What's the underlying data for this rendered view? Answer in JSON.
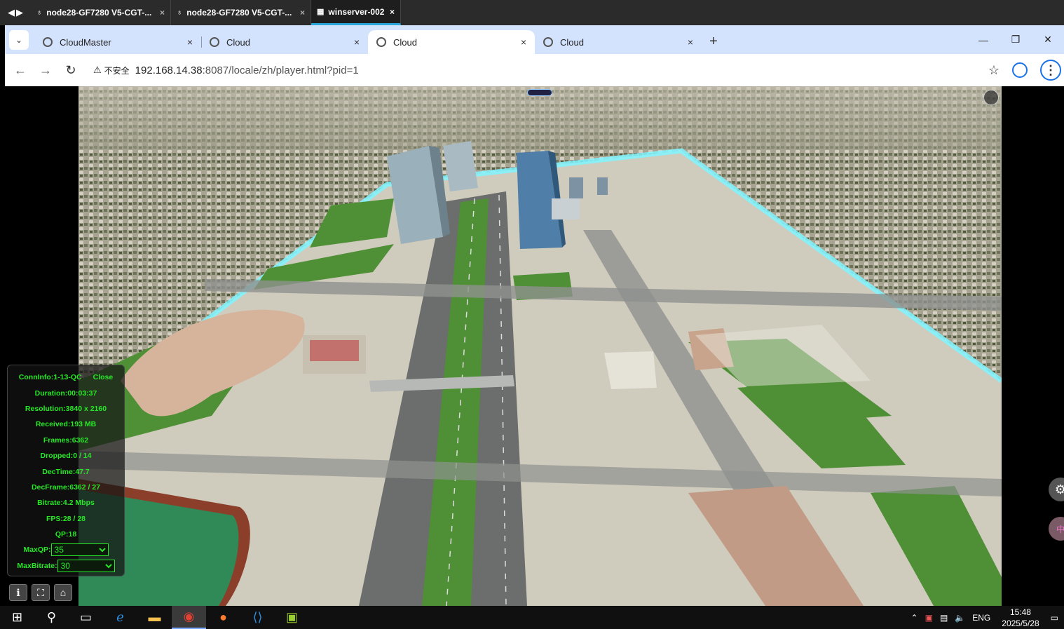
{
  "rdp": {
    "tabs": [
      {
        "label": "node28-GF7280 V5-CGT-...",
        "close": "×"
      },
      {
        "label": "node28-GF7280 V5-CGT-...",
        "close": "×"
      },
      {
        "label": "winserver-002",
        "close": "×",
        "active": true
      }
    ]
  },
  "browser": {
    "tabs": [
      {
        "title": "CloudMaster",
        "close": "×"
      },
      {
        "title": "Cloud",
        "close": "×"
      },
      {
        "title": "Cloud",
        "close": "×",
        "active": true
      },
      {
        "title": "Cloud",
        "close": "×"
      }
    ],
    "new_tab": "+",
    "security_label": "不安全",
    "url_host": "192.168.14.38",
    "url_rest": ":8087/locale/zh/player.html?pid=1"
  },
  "stats": {
    "conninfo_label": "ConnInfo:",
    "conninfo": "1-13-QC",
    "close": "Close",
    "duration_label": "Duration:",
    "duration": "00:03:37",
    "resolution_label": "Resolution:",
    "resolution": "3840 x 2160",
    "received_label": "Received:",
    "received": "193 MB",
    "frames_label": "Frames:",
    "frames": "6362",
    "dropped_label": "Dropped:",
    "dropped": "0 / 14",
    "dectime_label": "DecTime:",
    "dectime": "47.7",
    "decframe_label": "DecFrame:",
    "decframe": "6362 / 27",
    "bitrate_label": "Bitrate:",
    "bitrate": "4.2 Mbps",
    "fps_label": "FPS:",
    "fps": "28 / 28",
    "qp_label": "QP:",
    "qp": "18",
    "maxqp_label": "MaxQP:",
    "maxqp": "35",
    "maxbitrate_label": "MaxBitrate:",
    "maxbitrate": "30"
  },
  "taskbar": {
    "lang": "ENG",
    "time": "15:48",
    "date": "2025/5/28"
  },
  "colors": {
    "rdp_accent": "#2aa6d8",
    "chrome_tabstrip": "#d3e3fd",
    "stats_green": "#27e827"
  }
}
